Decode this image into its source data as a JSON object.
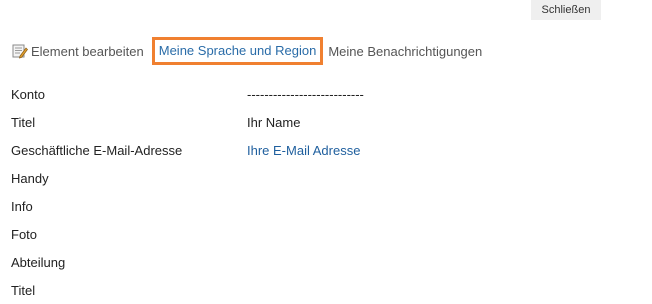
{
  "header": {
    "close_label": "Schließen"
  },
  "actions": {
    "edit_label": "Element bearbeiten",
    "language_label": "Meine Sprache und Region",
    "notifications_label": "Meine Benachrichtigungen"
  },
  "properties": [
    {
      "label": "Konto",
      "value": "---------------------------",
      "is_link": false
    },
    {
      "label": "Titel",
      "value": "Ihr Name",
      "is_link": false
    },
    {
      "label": "Geschäftliche E-Mail-Adresse",
      "value": "Ihre E-Mail Adresse",
      "is_link": true
    },
    {
      "label": "Handy",
      "value": "",
      "is_link": false
    },
    {
      "label": "Info",
      "value": "",
      "is_link": false
    },
    {
      "label": "Foto",
      "value": "",
      "is_link": false
    },
    {
      "label": "Abteilung",
      "value": "",
      "is_link": false
    },
    {
      "label": "Titel",
      "value": "",
      "is_link": false
    }
  ],
  "colors": {
    "highlight_border": "#f08030",
    "link": "#1f5f9e"
  }
}
